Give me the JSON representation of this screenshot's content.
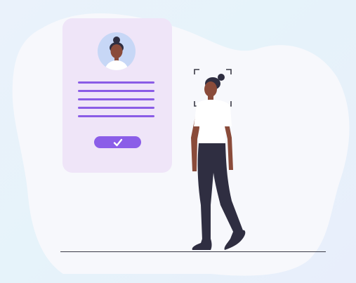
{
  "illustration": {
    "scene": "profile-verification",
    "colors": {
      "background": "#eaf3fb",
      "blob": "#f7f8fc",
      "card": "#efe5f8",
      "accent": "#8a5ce6",
      "avatar_bg": "#c7d7f6",
      "skin": "#8a4b3a",
      "hair": "#2f2e41",
      "shirt": "#ffffff",
      "pants": "#2f2e41",
      "ground": "#3a3a46"
    },
    "icons": {
      "confirm": "check-icon",
      "scan": "face-scan-brackets",
      "avatar": "person-avatar"
    }
  }
}
